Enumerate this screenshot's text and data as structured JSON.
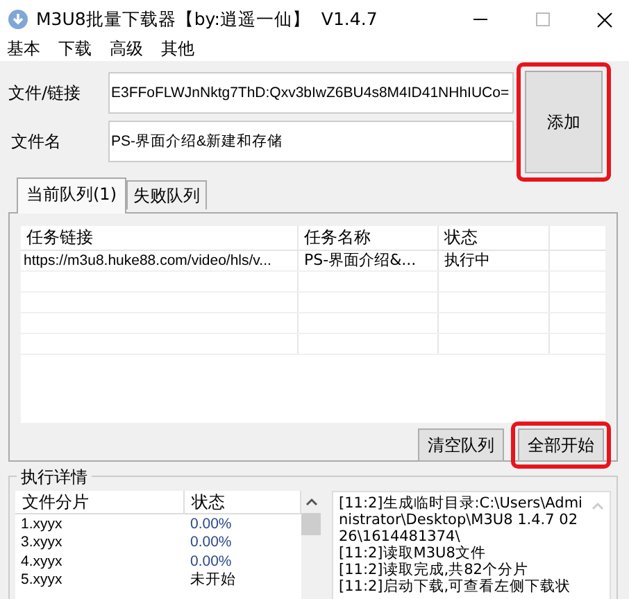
{
  "window": {
    "title": "M3U8批量下载器【by:逍遥一仙】  V1.4.7"
  },
  "menu": [
    "基本",
    "下载",
    "高级",
    "其他"
  ],
  "form": {
    "link_label": "文件/链接",
    "link_value": "E3FFoFLWJnNktg7ThD:Qxv3bIwZ6BU4s8M4ID41NHhIUCo=",
    "name_label": "文件名",
    "name_value": "PS-界面介绍&新建和存储"
  },
  "add_button": {
    "label": "添加",
    "highlighted": true
  },
  "tabs": [
    {
      "label": "当前队列(1)",
      "selected": true
    },
    {
      "label": "失败队列",
      "selected": false
    }
  ],
  "queue_table": {
    "columns": [
      "任务链接",
      "任务名称",
      "状态"
    ],
    "rows": [
      {
        "link": "https://m3u8.huke88.com/video/hls/v...",
        "name": "PS-界面介绍&...",
        "status": "执行中"
      }
    ]
  },
  "queue_buttons": [
    {
      "label": "清空队列",
      "highlighted": false
    },
    {
      "label": "全部开始",
      "highlighted": true
    }
  ],
  "details": {
    "title": "执行详情",
    "columns": [
      "文件分片",
      "状态"
    ],
    "segments": [
      {
        "file": "1.xyyx",
        "status": "0.00%",
        "color": "#2b4a8c"
      },
      {
        "file": "3.xyyx",
        "status": "0.00%",
        "color": "#2b4a8c"
      },
      {
        "file": "4.xyyx",
        "status": "0.00%",
        "color": "#2b4a8c"
      },
      {
        "file": "5.xyyx",
        "status": "未开始",
        "color": "#000000"
      }
    ],
    "log": [
      "[11:2]生成临时目录:C:\\Users\\Administrator\\Desktop\\M3U8 1.4.7 0226\\1614481374\\",
      "[11:2]读取M3U8文件",
      "[11:2]读取完成,共82个分片",
      "[11:2]启动下载,可查看左侧下载状"
    ]
  }
}
